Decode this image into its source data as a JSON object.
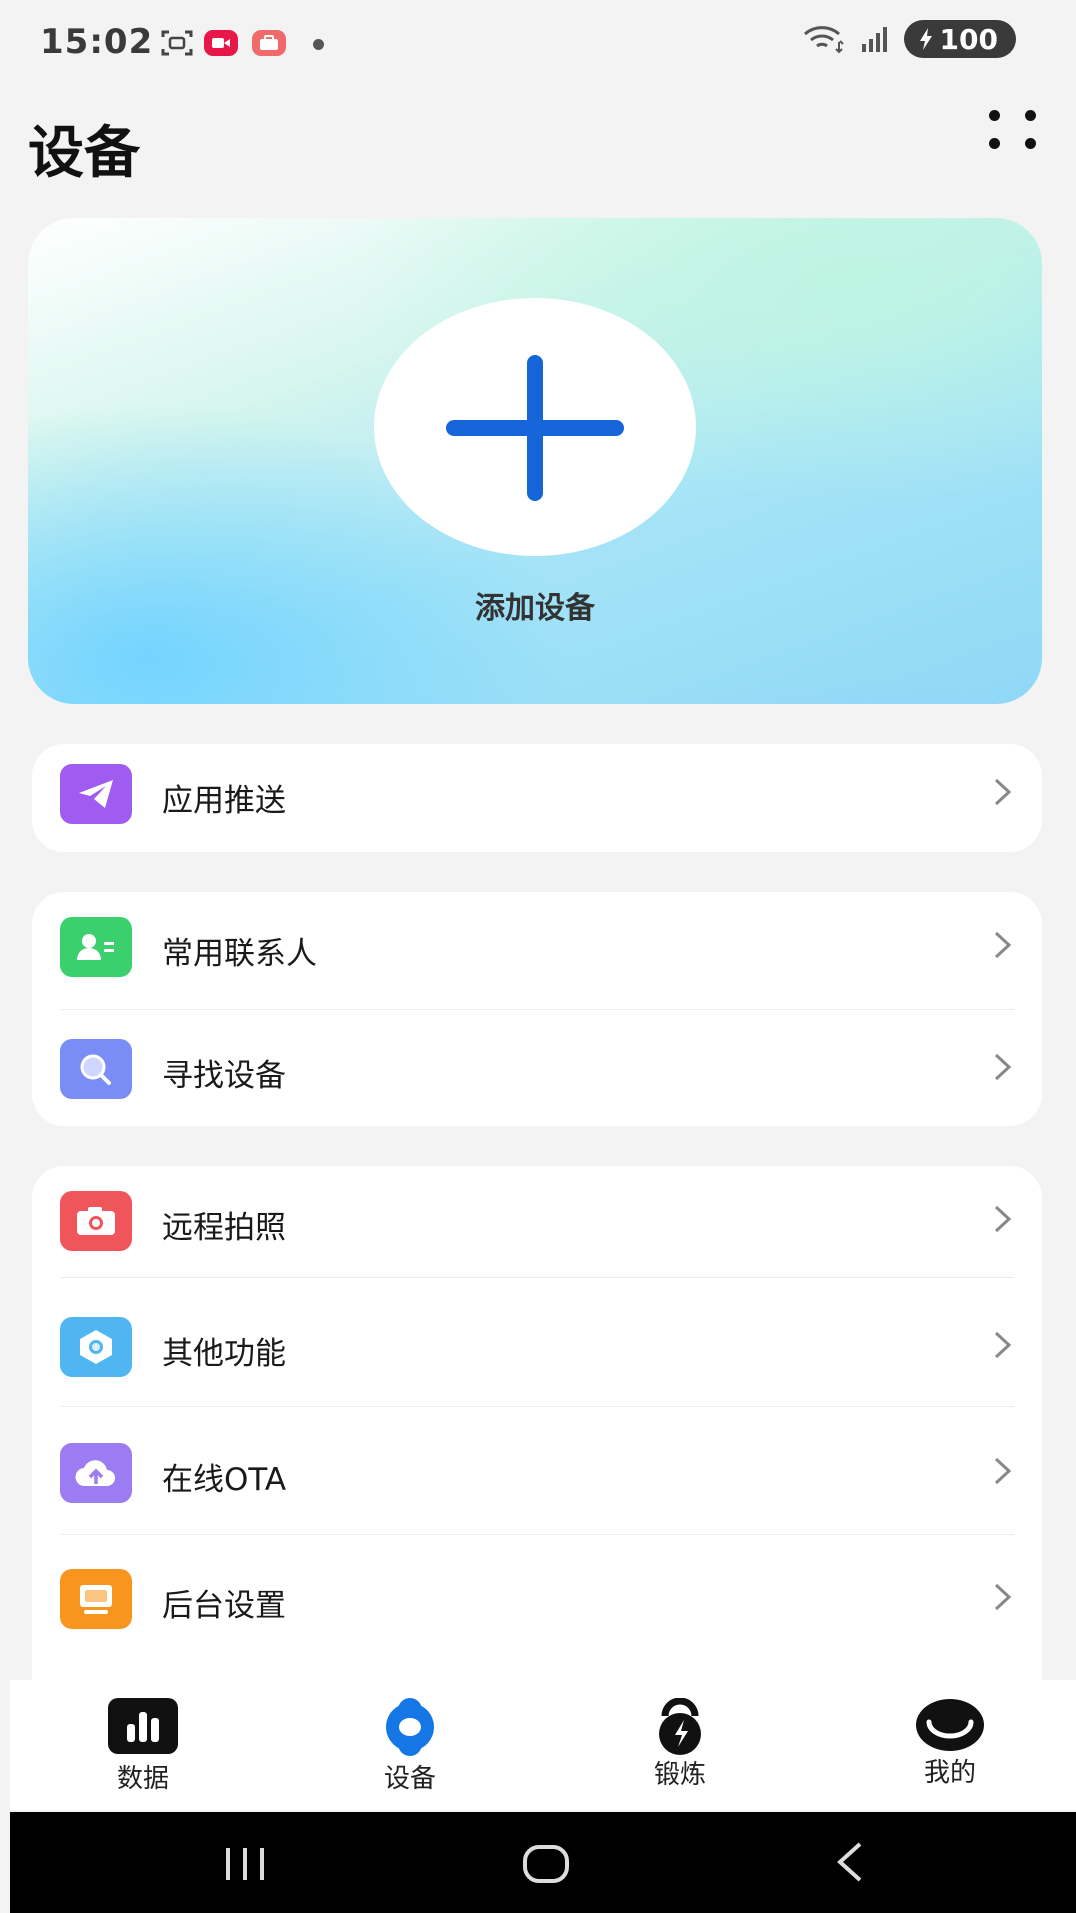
{
  "status_bar": {
    "time": "15:02",
    "battery": "100",
    "icons": [
      "screenshot-icon",
      "video-record-icon",
      "briefcase-icon",
      "notification-dot-icon",
      "wifi-icon",
      "signal-icon",
      "battery-charging-icon"
    ]
  },
  "header": {
    "title": "设备",
    "menu_icon": "four-dots-icon"
  },
  "hero": {
    "add_label": "添加设备",
    "plus_color": "#1565d8"
  },
  "groups": [
    {
      "items": [
        {
          "label": "应用推送",
          "icon": "paper-plane-icon",
          "color": "#a05cf0"
        }
      ]
    },
    {
      "items": [
        {
          "label": "常用联系人",
          "icon": "contact-card-icon",
          "color": "#3ccf6e"
        },
        {
          "label": "寻找设备",
          "icon": "search-device-icon",
          "color": "#7a8cf6"
        }
      ]
    },
    {
      "items": [
        {
          "label": "远程拍照",
          "icon": "camera-icon",
          "color": "#f0555c"
        },
        {
          "label": "其他功能",
          "icon": "hexagon-nut-icon",
          "color": "#4fb6f2"
        },
        {
          "label": "在线OTA",
          "icon": "cloud-upload-icon",
          "color": "#9b7cf2"
        },
        {
          "label": "后台设置",
          "icon": "monitor-icon",
          "color": "#f7951e"
        }
      ]
    }
  ],
  "bottom_nav": {
    "items": [
      {
        "label": "数据",
        "icon": "bar-chart-icon"
      },
      {
        "label": "设备",
        "icon": "watch-icon",
        "active": true,
        "active_color": "#1577e6"
      },
      {
        "label": "锻炼",
        "icon": "kettlebell-icon"
      },
      {
        "label": "我的",
        "icon": "smile-icon"
      }
    ]
  },
  "system_nav": {
    "icons": [
      "recent-apps-icon",
      "home-icon",
      "back-icon"
    ]
  }
}
